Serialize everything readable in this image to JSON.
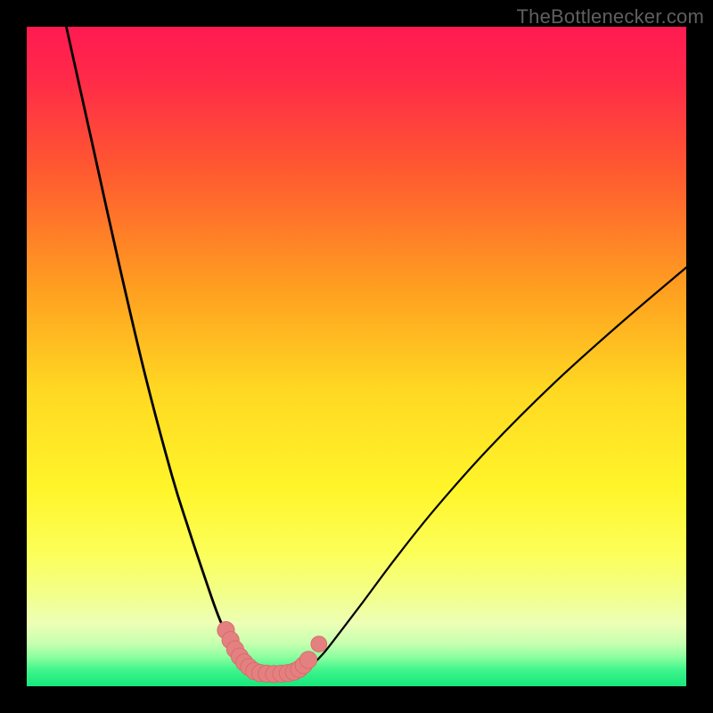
{
  "watermark": {
    "text": "TheBottlenecker.com"
  },
  "colors": {
    "frame": "#000000",
    "curve": "#000000",
    "marker_fill": "#e48080",
    "marker_stroke": "#d76a6a",
    "gradient_stops": [
      {
        "offset": 0.0,
        "color": "#ff1a52"
      },
      {
        "offset": 0.08,
        "color": "#ff2a48"
      },
      {
        "offset": 0.22,
        "color": "#ff5a30"
      },
      {
        "offset": 0.4,
        "color": "#ffa020"
      },
      {
        "offset": 0.55,
        "color": "#ffd822"
      },
      {
        "offset": 0.7,
        "color": "#fff52a"
      },
      {
        "offset": 0.8,
        "color": "#fcff5a"
      },
      {
        "offset": 0.86,
        "color": "#f2ff8a"
      },
      {
        "offset": 0.905,
        "color": "#ecffb5"
      },
      {
        "offset": 0.935,
        "color": "#c7ffb0"
      },
      {
        "offset": 0.955,
        "color": "#8effa0"
      },
      {
        "offset": 0.975,
        "color": "#40f58c"
      },
      {
        "offset": 1.0,
        "color": "#15e87b"
      }
    ]
  },
  "chart_data": {
    "type": "line",
    "title": "",
    "xlabel": "",
    "ylabel": "",
    "xlim": [
      0,
      100
    ],
    "ylim": [
      0,
      100
    ],
    "grid": false,
    "legend": false,
    "series": [
      {
        "name": "left-curve",
        "x": [
          6,
          10,
          14,
          18,
          22,
          24.5,
          27,
          29,
          30.8,
          32.2,
          33.3,
          34.2,
          34.8
        ],
        "y": [
          100,
          82,
          64,
          47,
          32,
          24,
          16.5,
          10.8,
          6.8,
          4.4,
          3.0,
          2.3,
          2.1
        ]
      },
      {
        "name": "right-curve",
        "x": [
          41.2,
          42.0,
          43.2,
          45.0,
          47.5,
          51.0,
          56.0,
          62.0,
          70.0,
          80.0,
          90.0,
          100.0
        ],
        "y": [
          2.1,
          2.4,
          3.2,
          5.0,
          8.2,
          12.8,
          19.5,
          27.0,
          36.0,
          46.0,
          55.0,
          63.5
        ]
      },
      {
        "name": "valley-floor",
        "x": [
          34.8,
          36.0,
          37.5,
          39.0,
          40.2,
          41.2
        ],
        "y": [
          2.1,
          1.9,
          1.85,
          1.9,
          2.0,
          2.1
        ]
      }
    ],
    "markers": [
      {
        "x": 30.2,
        "y": 8.5,
        "r": 1.3
      },
      {
        "x": 30.9,
        "y": 7.0,
        "r": 1.3
      },
      {
        "x": 31.6,
        "y": 5.6,
        "r": 1.3
      },
      {
        "x": 32.3,
        "y": 4.5,
        "r": 1.3
      },
      {
        "x": 33.0,
        "y": 3.6,
        "r": 1.3
      },
      {
        "x": 33.7,
        "y": 2.9,
        "r": 1.3
      },
      {
        "x": 34.5,
        "y": 2.3,
        "r": 1.3
      },
      {
        "x": 35.4,
        "y": 2.0,
        "r": 1.3
      },
      {
        "x": 36.4,
        "y": 1.9,
        "r": 1.3
      },
      {
        "x": 37.5,
        "y": 1.85,
        "r": 1.3
      },
      {
        "x": 38.6,
        "y": 1.9,
        "r": 1.3
      },
      {
        "x": 39.6,
        "y": 2.0,
        "r": 1.3
      },
      {
        "x": 40.5,
        "y": 2.2,
        "r": 1.3
      },
      {
        "x": 41.3,
        "y": 2.6,
        "r": 1.3
      },
      {
        "x": 42.0,
        "y": 3.2,
        "r": 1.3
      },
      {
        "x": 42.7,
        "y": 4.0,
        "r": 1.3
      },
      {
        "x": 44.3,
        "y": 6.4,
        "r": 1.2
      }
    ]
  }
}
